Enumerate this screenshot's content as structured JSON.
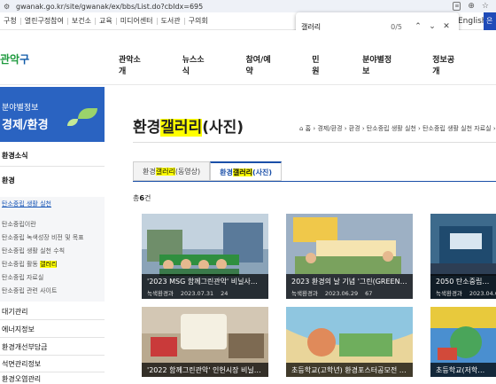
{
  "browser": {
    "url": "gwanak.go.kr/site/gwanak/ex/bbs/List.do?cbIdx=695"
  },
  "find": {
    "query": "갤러리",
    "count": "0/5"
  },
  "util": {
    "links": [
      "구청",
      "열린구정참여",
      "보건소",
      "교육",
      "미디어센터",
      "도서관",
      "구의회"
    ],
    "english": "English"
  },
  "header": {
    "logo_a": "관악",
    "logo_b": "구",
    "nav": [
      "관악소개",
      "뉴스소식",
      "참여/예약",
      "민원",
      "분야별정보",
      "정보공개"
    ]
  },
  "sidebar": {
    "title_small": "분야별정보",
    "title_big": "경제/환경",
    "item1": "환경소식",
    "item2": "환경",
    "sub_head": "탄소중립 생활 실천",
    "subs": [
      "탄소중립이란",
      "탄소중립 녹색성장 비전 및 목표",
      "탄소중립 생활 실천 수칙"
    ],
    "sub_active_pre": "탄소중립 활동 ",
    "sub_active_hl": "갤러리",
    "subs2": [
      "탄소중립 자료실",
      "탄소중립 관련 사이트"
    ],
    "more": [
      "대기관리",
      "에너지정보",
      "환경개선부담금",
      "석면관리정보",
      "환경오염관리"
    ]
  },
  "content": {
    "title_pre": "환경",
    "title_hl": "갤러리",
    "title_post": "(사진)",
    "breadcrumb": "홈 › 경제/환경 › 환경 › 탄소중립 생활 실천 › 탄소중립 생활 실천 자료실 › 환경갤러리",
    "tab1_pre": "환경",
    "tab1_hl": "갤러리",
    "tab1_post": "(동영상)",
    "tab2_pre": "환경",
    "tab2_hl": "갤러리",
    "tab2_post": "(사진)",
    "total_pre": "총",
    "total_count": "6",
    "total_post": "건"
  },
  "cards": [
    {
      "title": "'2023 MSG 함께그린관악' 비닐사용 ...",
      "dept": "녹색환경과",
      "date": "2023.07.31",
      "views": "24"
    },
    {
      "title": "2023 환경의 날 기념 '그린(GREEN)데...",
      "dept": "녹색환경과",
      "date": "2023.06.29",
      "views": "67"
    },
    {
      "title": "2050 탄소중립 '원팀'",
      "dept": "녹색환경과",
      "date": "2023.04.0",
      "views": ""
    },
    {
      "title": "'2022 함께그린관악' 인헌시장 비닐사...",
      "dept": "",
      "date": "",
      "views": ""
    },
    {
      "title": "초등학교(고학년) 환경포스터공모전 수...",
      "dept": "",
      "date": "",
      "views": ""
    },
    {
      "title": "초등학교(저학년) 환경",
      "dept": "",
      "date": "",
      "views": ""
    }
  ]
}
